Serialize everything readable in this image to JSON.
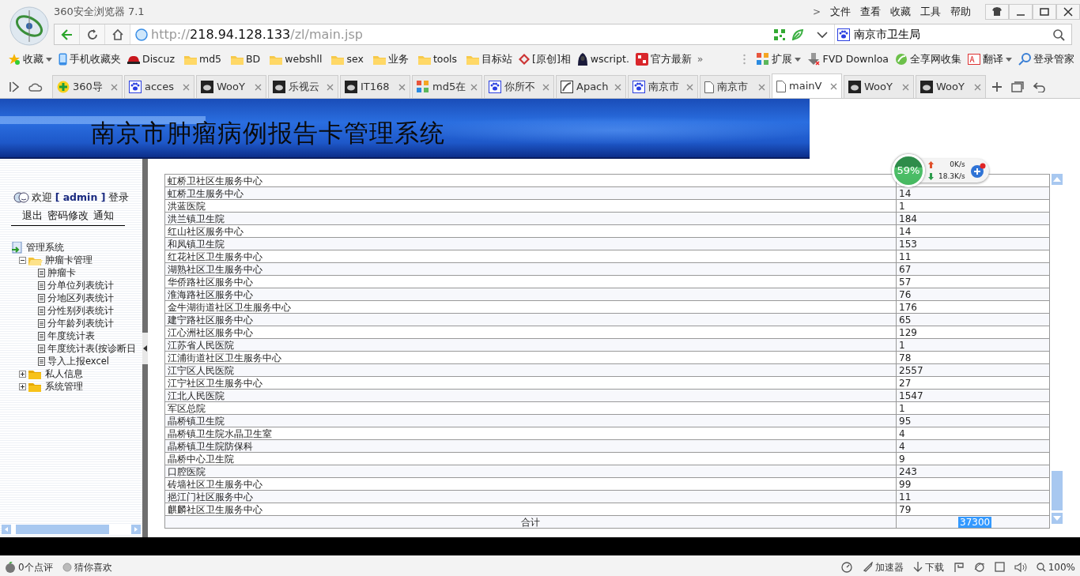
{
  "window": {
    "title": "360安全浏览器 7.1",
    "menu_chevron": ">",
    "menu": [
      "文件",
      "查看",
      "收藏",
      "工具",
      "帮助"
    ]
  },
  "address_bar": {
    "scheme": "http://",
    "host": "218.94.128.133",
    "path": "/zl/main.jsp",
    "search_value": "南京市卫生局"
  },
  "bookmarks": [
    {
      "label": "收藏",
      "dropdown": true
    },
    {
      "label": "手机收藏夹",
      "dropdown": false
    },
    {
      "label": "Discuz",
      "dropdown": false
    },
    {
      "label": "md5",
      "dropdown": false
    },
    {
      "label": "BD",
      "dropdown": false
    },
    {
      "label": "webshll",
      "dropdown": false
    },
    {
      "label": "sex",
      "dropdown": false
    },
    {
      "label": "业务",
      "dropdown": false
    },
    {
      "label": "tools",
      "dropdown": false
    },
    {
      "label": "目标站",
      "dropdown": false
    },
    {
      "label": "[原创]相",
      "dropdown": false
    },
    {
      "label": "wscript.",
      "dropdown": false
    },
    {
      "label": "官方最新",
      "dropdown": false
    }
  ],
  "bookmarks_more": "»",
  "toolbar": [
    {
      "label": "扩展",
      "dropdown": true
    },
    {
      "label": "FVD Downloa",
      "dropdown": false
    },
    {
      "label": "全享网收集",
      "dropdown": false
    },
    {
      "label": "翻译",
      "dropdown": true
    },
    {
      "label": "登录管家",
      "dropdown": false
    }
  ],
  "tabs": [
    {
      "label": "360导",
      "selected": false
    },
    {
      "label": "acces",
      "selected": false
    },
    {
      "label": "WooY",
      "selected": false
    },
    {
      "label": "乐视云",
      "selected": false
    },
    {
      "label": "IT168",
      "selected": false
    },
    {
      "label": "md5在",
      "selected": false
    },
    {
      "label": "你所不",
      "selected": false
    },
    {
      "label": "Apach",
      "selected": false
    },
    {
      "label": "南京市",
      "selected": false
    },
    {
      "label": "南京市",
      "selected": false
    },
    {
      "label": "mainV",
      "selected": true
    },
    {
      "label": "WooY",
      "selected": false
    },
    {
      "label": "WooY",
      "selected": false
    }
  ],
  "page": {
    "header_title": "南京市肿瘤病例报告卡管理系统",
    "sidebar": {
      "welcome_prefix": "欢迎",
      "user": "[ admin ]",
      "welcome_suffix": "登录",
      "links": [
        "退出",
        "密码修改",
        "通知"
      ],
      "tree": [
        {
          "label": "管理系统",
          "kind": "root",
          "children": [
            {
              "label": "肿瘤卡管理",
              "kind": "folder",
              "expanded": true,
              "children": [
                {
                  "label": "肿瘤卡",
                  "kind": "page"
                },
                {
                  "label": "分单位列表统计",
                  "kind": "page"
                },
                {
                  "label": "分地区列表统计",
                  "kind": "page"
                },
                {
                  "label": "分性别列表统计",
                  "kind": "page"
                },
                {
                  "label": "分年龄列表统计",
                  "kind": "page"
                },
                {
                  "label": "年度统计表",
                  "kind": "page"
                },
                {
                  "label": "年度统计表(按诊断日",
                  "kind": "page"
                },
                {
                  "label": "导入上报excel",
                  "kind": "page"
                }
              ]
            },
            {
              "label": "私人信息",
              "kind": "folder",
              "expanded": false
            },
            {
              "label": "系统管理",
              "kind": "folder",
              "expanded": false
            }
          ]
        }
      ]
    },
    "table": {
      "rows": [
        {
          "name": "虹桥卫社区生服务中心"
        },
        {
          "name": "虹桥卫生服务中心",
          "value": "14"
        },
        {
          "name": "洪蓝医院",
          "value": "1"
        },
        {
          "name": "洪兰镇卫生院",
          "value": "184"
        },
        {
          "name": "红山社区服务中心",
          "value": "14"
        },
        {
          "name": "和凤镇卫生院",
          "value": "153"
        },
        {
          "name": "红花社区卫生服务中心",
          "value": "11"
        },
        {
          "name": "湖熟社区卫生服务中心",
          "value": "67"
        },
        {
          "name": "华侨路社区服务中心",
          "value": "57"
        },
        {
          "name": "淮海路社区服务中心",
          "value": "76"
        },
        {
          "name": "金牛湖街道社区卫生服务中心",
          "value": "176"
        },
        {
          "name": "建宁路社区服务中心",
          "value": "65"
        },
        {
          "name": "江心洲社区服务中心",
          "value": "129"
        },
        {
          "name": "江苏省人民医院",
          "value": "1"
        },
        {
          "name": "江浦街道社区卫生服务中心",
          "value": "78"
        },
        {
          "name": "江宁区人民医院",
          "value": "2557"
        },
        {
          "name": "江宁社区卫生服务中心",
          "value": "27"
        },
        {
          "name": "江北人民医院",
          "value": "1547"
        },
        {
          "name": "军区总院",
          "value": "1"
        },
        {
          "name": "晶桥镇卫生院",
          "value": "95"
        },
        {
          "name": "晶桥镇卫生院水晶卫生室",
          "value": "4"
        },
        {
          "name": "晶桥镇卫生院防保科",
          "value": "4"
        },
        {
          "name": "晶桥中心卫生院",
          "value": "9"
        },
        {
          "name": "口腔医院",
          "value": "243"
        },
        {
          "name": "砖墙社区卫生服务中心",
          "value": "99"
        },
        {
          "name": "挹江门社区服务中心",
          "value": "11"
        },
        {
          "name": "麒麟社区卫生服务中心",
          "value": "79"
        }
      ],
      "total": {
        "label": "合计",
        "value": "37300",
        "selected": true
      }
    }
  },
  "speed_widget": {
    "memory": "59%",
    "upload": "0K/s",
    "download": "18.3K/s"
  },
  "status_bar": {
    "left": [
      "0个点评",
      "猜你喜欢"
    ],
    "accelerator": "加速器",
    "download": "下载",
    "zoom": "100%"
  }
}
